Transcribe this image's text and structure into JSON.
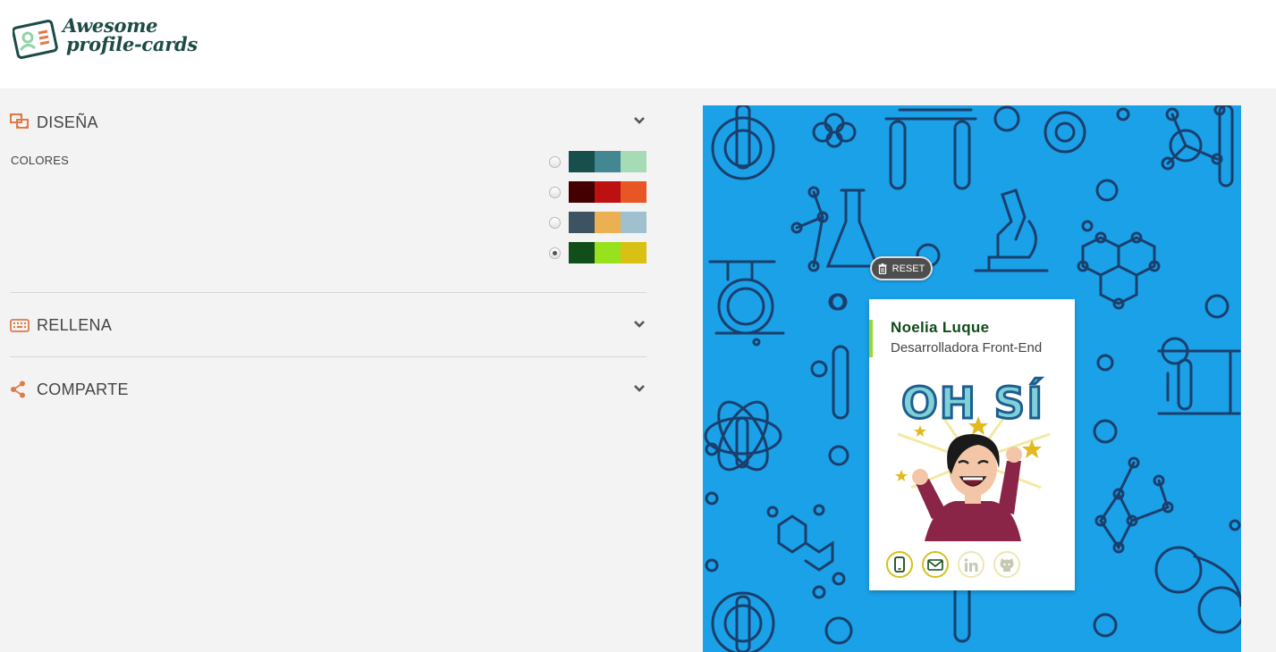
{
  "header": {
    "logo_line1": "Awesome",
    "logo_line2": "profile-cards"
  },
  "sections": {
    "design": {
      "title": "DISEÑA",
      "colors_label": "COLORES"
    },
    "fill": {
      "title": "RELLENA"
    },
    "share": {
      "title": "COMPARTE"
    }
  },
  "palettes": [
    {
      "colors": [
        "#174f4c",
        "#438792",
        "#a6dcb5"
      ],
      "selected": false
    },
    {
      "colors": [
        "#420000",
        "#bd1010",
        "#e95626"
      ],
      "selected": false
    },
    {
      "colors": [
        "#3e5362",
        "#eab052",
        "#a0c0cf"
      ],
      "selected": false
    },
    {
      "colors": [
        "#114e1a",
        "#97e21c",
        "#d8c114"
      ],
      "selected": true
    }
  ],
  "preview": {
    "reset_label": "RESET",
    "card": {
      "name": "Noelia Luque",
      "job": "Desarrolladora Front-End"
    },
    "sticker_text": "OH SÍ"
  },
  "icons": {
    "phone": "phone-icon",
    "email": "email-icon",
    "linkedin": "linkedin-icon",
    "github": "github-icon"
  },
  "colors": {
    "accent_orange": "#e07a49",
    "preview_bg": "#1aa1e8",
    "pattern_stroke": "#1b3f6c",
    "card_name": "#104b1a",
    "card_bar": "#9ad72c",
    "link_border": "#d5c01c"
  }
}
